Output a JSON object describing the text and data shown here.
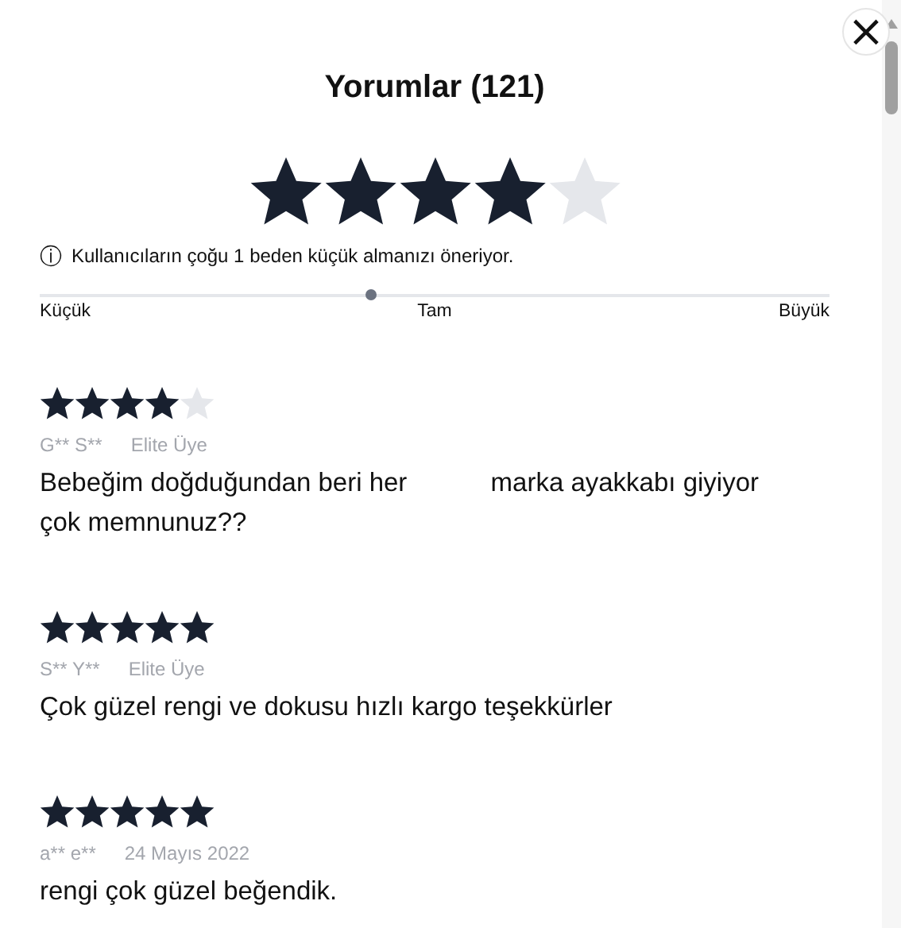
{
  "title": "Yorumlar (121)",
  "rating": {
    "stars": 4
  },
  "size_hint": {
    "icon": "ⓘ",
    "text": "Kullanıcıların çoğu 1 beden küçük almanızı öneriyor.",
    "level": 0.42,
    "labels": [
      "Küçük",
      "Tam",
      "Büyük"
    ]
  },
  "close": {
    "label": "×"
  },
  "reviews": [
    {
      "stars": 4,
      "author": "G** S**",
      "badge": "Elite Üye",
      "body": [
        "Bebeğim doğduğundan beri her",
        "marka ayakkabı giyiyor çok memnunuz??"
      ]
    },
    {
      "stars": 5,
      "author": "S** Y**",
      "badge": "Elite Üye",
      "body": [
        "Çok güzel rengi ve dokusu hızlı kargo teşekkürler"
      ]
    },
    {
      "stars": 5,
      "author": "a** e**",
      "badge": "24 Mayıs 2022",
      "body": [
        "rengi çok güzel beğendik."
      ]
    }
  ]
}
